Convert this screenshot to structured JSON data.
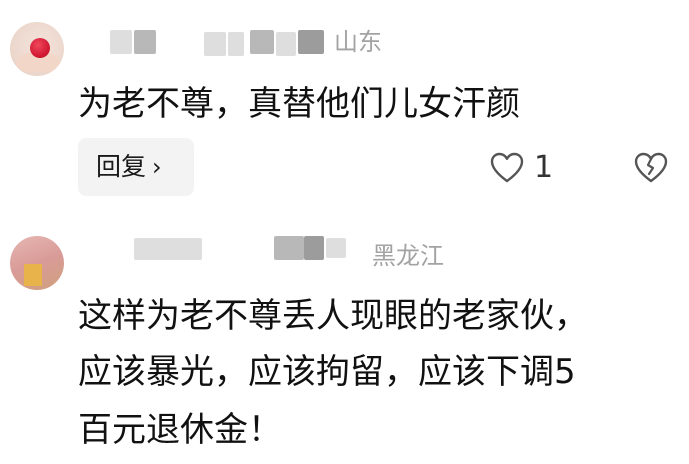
{
  "comments": [
    {
      "location": "山东",
      "text_lines": [
        "为老不尊，真替他们儿女汗颜"
      ],
      "reply_label": "回复",
      "reply_chevron": "›",
      "like_count": "1",
      "icons": {
        "like": "heart-outline-icon",
        "dislike": "broken-heart-icon",
        "chevron": "chevron-right-icon"
      }
    },
    {
      "location": "黑龙江",
      "text_lines": [
        "这样为老不尊丢人现眼的老家伙，",
        "应该暴光，应该拘留，应该下调5",
        "百元退休金！"
      ]
    }
  ]
}
